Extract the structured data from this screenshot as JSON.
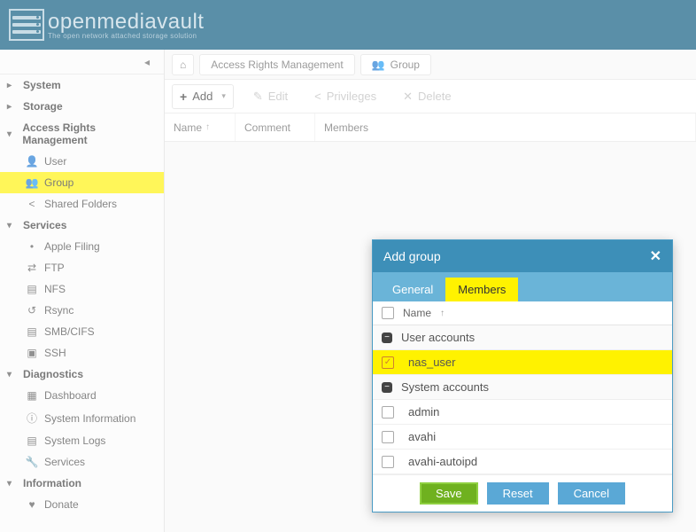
{
  "brand": {
    "name": "openmediavault",
    "tagline": "The open network attached storage solution"
  },
  "sidebar": {
    "items": [
      {
        "label": "System",
        "icon": "plus-square",
        "level": 0
      },
      {
        "label": "Storage",
        "icon": "plus-square",
        "level": 0
      },
      {
        "label": "Access Rights Management",
        "icon": "minus-square",
        "level": 0
      },
      {
        "label": "User",
        "icon": "user",
        "level": 1
      },
      {
        "label": "Group",
        "icon": "users",
        "level": 1,
        "highlight": true
      },
      {
        "label": "Shared Folders",
        "icon": "share",
        "level": 1
      },
      {
        "label": "Services",
        "icon": "minus-square",
        "level": 0
      },
      {
        "label": "Apple Filing",
        "icon": "apple",
        "level": 1
      },
      {
        "label": "FTP",
        "icon": "transfer",
        "level": 1
      },
      {
        "label": "NFS",
        "icon": "folder",
        "level": 1
      },
      {
        "label": "Rsync",
        "icon": "sync",
        "level": 1
      },
      {
        "label": "SMB/CIFS",
        "icon": "folder",
        "level": 1
      },
      {
        "label": "SSH",
        "icon": "terminal",
        "level": 1
      },
      {
        "label": "Diagnostics",
        "icon": "minus-square",
        "level": 0
      },
      {
        "label": "Dashboard",
        "icon": "dashboard",
        "level": 1
      },
      {
        "label": "System Information",
        "icon": "info",
        "level": 1
      },
      {
        "label": "System Logs",
        "icon": "file",
        "level": 1
      },
      {
        "label": "Services",
        "icon": "wrench",
        "level": 1
      },
      {
        "label": "Information",
        "icon": "minus-square",
        "level": 0
      },
      {
        "label": "Donate",
        "icon": "heart",
        "level": 1
      }
    ]
  },
  "breadcrumb": {
    "items": [
      {
        "label": "Access Rights Management"
      },
      {
        "label": "Group",
        "icon": "users"
      }
    ]
  },
  "toolbar": {
    "add": "Add",
    "edit": "Edit",
    "privileges": "Privileges",
    "delete": "Delete"
  },
  "grid": {
    "columns": [
      "Name",
      "Comment",
      "Members"
    ]
  },
  "dialog": {
    "title": "Add group",
    "tabs": {
      "general": "General",
      "members": "Members"
    },
    "header": "Name",
    "groups": [
      {
        "label": "User accounts",
        "items": [
          {
            "name": "nas_user",
            "checked": true
          }
        ]
      },
      {
        "label": "System accounts",
        "items": [
          {
            "name": "admin",
            "checked": false
          },
          {
            "name": "avahi",
            "checked": false
          },
          {
            "name": "avahi-autoipd",
            "checked": false
          }
        ]
      }
    ],
    "buttons": {
      "save": "Save",
      "reset": "Reset",
      "cancel": "Cancel"
    }
  }
}
